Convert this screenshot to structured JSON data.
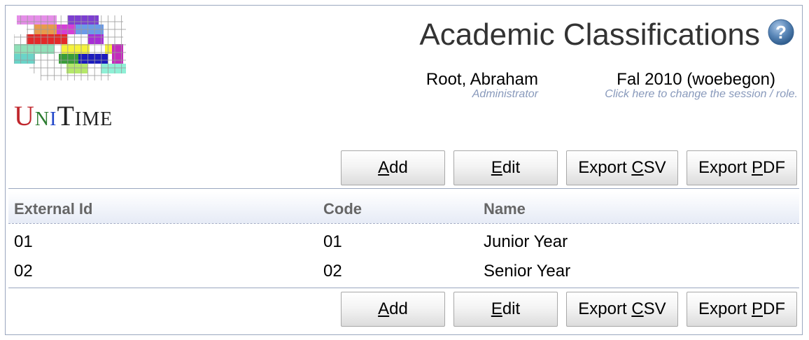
{
  "app": {
    "logo_text": "UniTime",
    "logo_parts": {
      "u": "U",
      "n": "N",
      "i": "I",
      "t": "T",
      "ime": "IME"
    }
  },
  "header": {
    "title": "Academic Classifications",
    "user_name": "Root, Abraham",
    "user_role": "Administrator",
    "session": "Fal 2010 (woebegon)",
    "session_hint": "Click here to change the session / role."
  },
  "buttons": {
    "add": {
      "before": "",
      "key": "A",
      "after": "dd"
    },
    "edit": {
      "before": "",
      "key": "E",
      "after": "dit"
    },
    "export_csv": {
      "before": "Export ",
      "key": "C",
      "after": "SV"
    },
    "export_pdf": {
      "before": "Export ",
      "key": "P",
      "after": "DF"
    }
  },
  "table": {
    "columns": [
      "External Id",
      "Code",
      "Name"
    ],
    "rows": [
      [
        "01",
        "01",
        "Junior Year"
      ],
      [
        "02",
        "02",
        "Senior Year"
      ]
    ]
  },
  "icons": {
    "help": "help-icon",
    "help_glyph": "?"
  },
  "colors": {
    "border": "#9aa7bf",
    "link_hint": "#8899bb",
    "header_bg": "#e6ebf6",
    "help_blue": "#4a77a8"
  }
}
